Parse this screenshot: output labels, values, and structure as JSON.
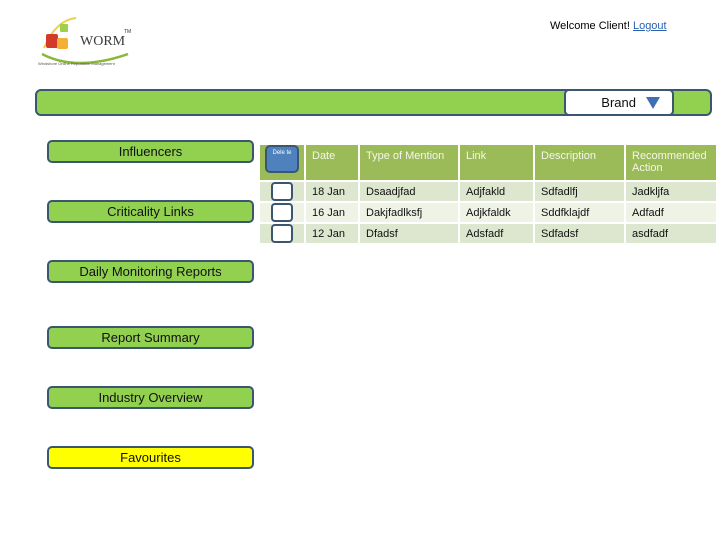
{
  "header": {
    "logo": {
      "name": "WORM",
      "tm": "TM",
      "tagline": "Windshore Online Reputation Management"
    },
    "welcome_text": "Welcome Client!",
    "logout_label": "Logout"
  },
  "topbar": {
    "brand_select": {
      "selected": "Brand"
    }
  },
  "sidebar": {
    "items": [
      {
        "label": "Influencers",
        "color": "#92d050"
      },
      {
        "label": "Criticality Links",
        "color": "#92d050"
      },
      {
        "label": "Daily Monitoring Reports",
        "color": "#92d050"
      },
      {
        "label": "Report Summary",
        "color": "#92d050"
      },
      {
        "label": "Industry Overview",
        "color": "#92d050"
      },
      {
        "label": "Favourites",
        "color": "#ffff00"
      }
    ]
  },
  "table": {
    "delete_label": "Dele te",
    "columns": [
      "Date",
      "Type of Mention",
      "Link",
      "Description",
      "Recommended Action"
    ],
    "rows": [
      {
        "date": "18 Jan",
        "type": "Dsaadjfad",
        "link": "Adjfakld",
        "description": "Sdfadlfj",
        "action": "Jadkljfa"
      },
      {
        "date": "16 Jan",
        "type": "Dakjfadlksfj",
        "link": "Adjkfaldk",
        "description": "Sddfklajdf",
        "action": "Adfadf"
      },
      {
        "date": "12 Jan",
        "type": "Dfadsf",
        "link": "Adsfadf",
        "description": "Sdfadsf",
        "action": "asdfadf"
      }
    ]
  }
}
